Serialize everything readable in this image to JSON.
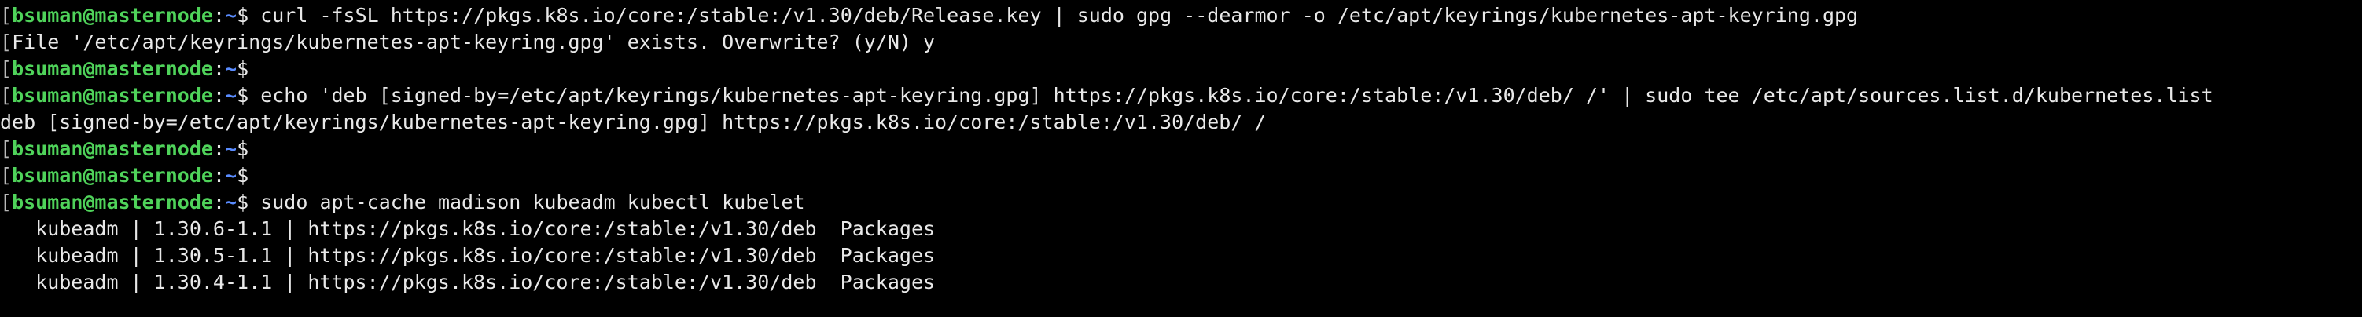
{
  "prompt": {
    "bracket": "[",
    "user_host": "bsuman@masternode",
    "separator": ":",
    "cwd": "~",
    "symbol": "$"
  },
  "lines": [
    {
      "kind": "prompt",
      "command": "curl -fsSL https://pkgs.k8s.io/core:/stable:/v1.30/deb/Release.key | sudo gpg --dearmor -o /etc/apt/keyrings/kubernetes-apt-keyring.gpg"
    },
    {
      "kind": "output",
      "prefix": "[",
      "text": "File '/etc/apt/keyrings/kubernetes-apt-keyring.gpg' exists. Overwrite? (y/N) y"
    },
    {
      "kind": "prompt",
      "command": ""
    },
    {
      "kind": "prompt",
      "command": "echo 'deb [signed-by=/etc/apt/keyrings/kubernetes-apt-keyring.gpg] https://pkgs.k8s.io/core:/stable:/v1.30/deb/ /' | sudo tee /etc/apt/sources.list.d/kubernetes.list"
    },
    {
      "kind": "output",
      "prefix": "",
      "text": "deb [signed-by=/etc/apt/keyrings/kubernetes-apt-keyring.gpg] https://pkgs.k8s.io/core:/stable:/v1.30/deb/ /"
    },
    {
      "kind": "prompt",
      "command": ""
    },
    {
      "kind": "prompt",
      "command": ""
    },
    {
      "kind": "prompt",
      "command": "sudo apt-cache madison kubeadm kubectl kubelet"
    },
    {
      "kind": "output",
      "prefix": "",
      "text": "   kubeadm | 1.30.6-1.1 | https://pkgs.k8s.io/core:/stable:/v1.30/deb  Packages"
    },
    {
      "kind": "output",
      "prefix": "",
      "text": "   kubeadm | 1.30.5-1.1 | https://pkgs.k8s.io/core:/stable:/v1.30/deb  Packages"
    },
    {
      "kind": "output",
      "prefix": "",
      "text": "   kubeadm | 1.30.4-1.1 | https://pkgs.k8s.io/core:/stable:/v1.30/deb  Packages"
    }
  ]
}
